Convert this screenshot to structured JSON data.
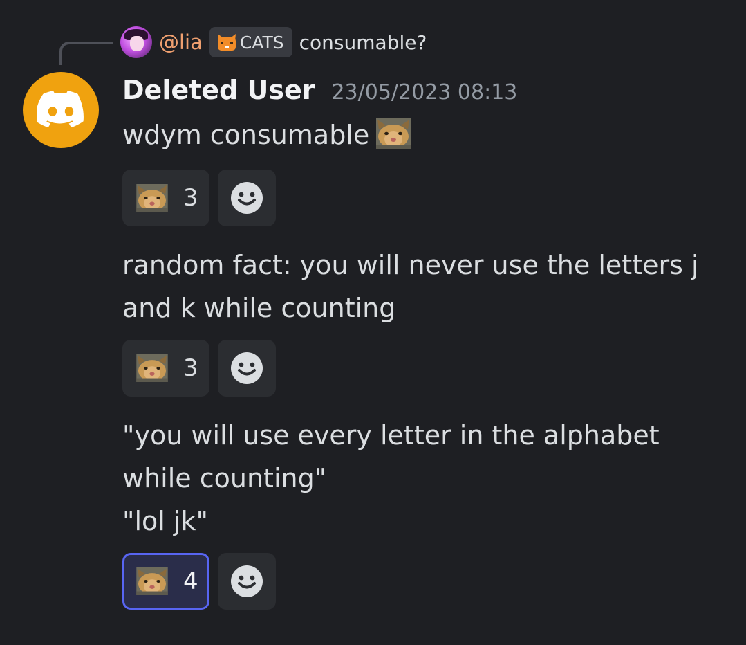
{
  "reply": {
    "username": "@lia",
    "tag_label": "CATS",
    "tag_icon": "cat-face-icon",
    "text": "consumable?"
  },
  "author": {
    "name": "Deleted User",
    "timestamp": "23/05/2023 08:13",
    "avatar_icon": "discord-logo-icon",
    "avatar_color": "#f0a20f"
  },
  "messages": [
    {
      "lines": [
        "wdym consumable"
      ],
      "inline_emoji": "cat-face-emoji",
      "reaction": {
        "emoji": "cat-face-emoji",
        "count": "3",
        "active": false
      }
    },
    {
      "lines": [
        "random fact: you will never use the letters j",
        "and k while counting"
      ],
      "reaction": {
        "emoji": "cat-face-emoji",
        "count": "3",
        "active": false
      }
    },
    {
      "lines": [
        "\"you will use every letter in the alphabet",
        "while counting\"",
        "\"lol jk\""
      ],
      "reaction": {
        "emoji": "cat-face-emoji",
        "count": "4",
        "active": true
      }
    }
  ],
  "colors": {
    "background": "#1e1f23",
    "reply_name": "#f0a070",
    "active_reaction_border": "#5865f2"
  }
}
